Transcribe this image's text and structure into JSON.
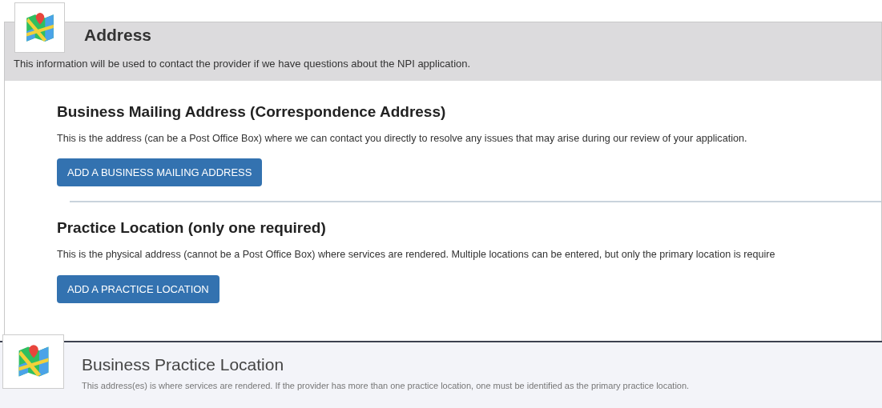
{
  "address_panel": {
    "title": "Address",
    "description": "This information will be used to contact the provider if we have questions about the NPI application.",
    "sections": [
      {
        "title": "Business Mailing Address (Correspondence Address)",
        "description": "This is the address (can be a Post Office Box) where we can contact you directly to resolve any issues that may arise during our review of your application.",
        "button": "ADD A BUSINESS MAILING ADDRESS"
      },
      {
        "title": "Practice Location (only one required)",
        "description": "This is the physical address (cannot be a Post Office Box) where services are rendered. Multiple locations can be entered, but only the primary location is require",
        "button": "ADD A PRACTICE LOCATION"
      }
    ]
  },
  "practice_panel": {
    "title": "Business Practice Location",
    "description": "This address(es) is where services are rendered. If the provider has more than one practice location, one must be identified as the primary practice location."
  }
}
